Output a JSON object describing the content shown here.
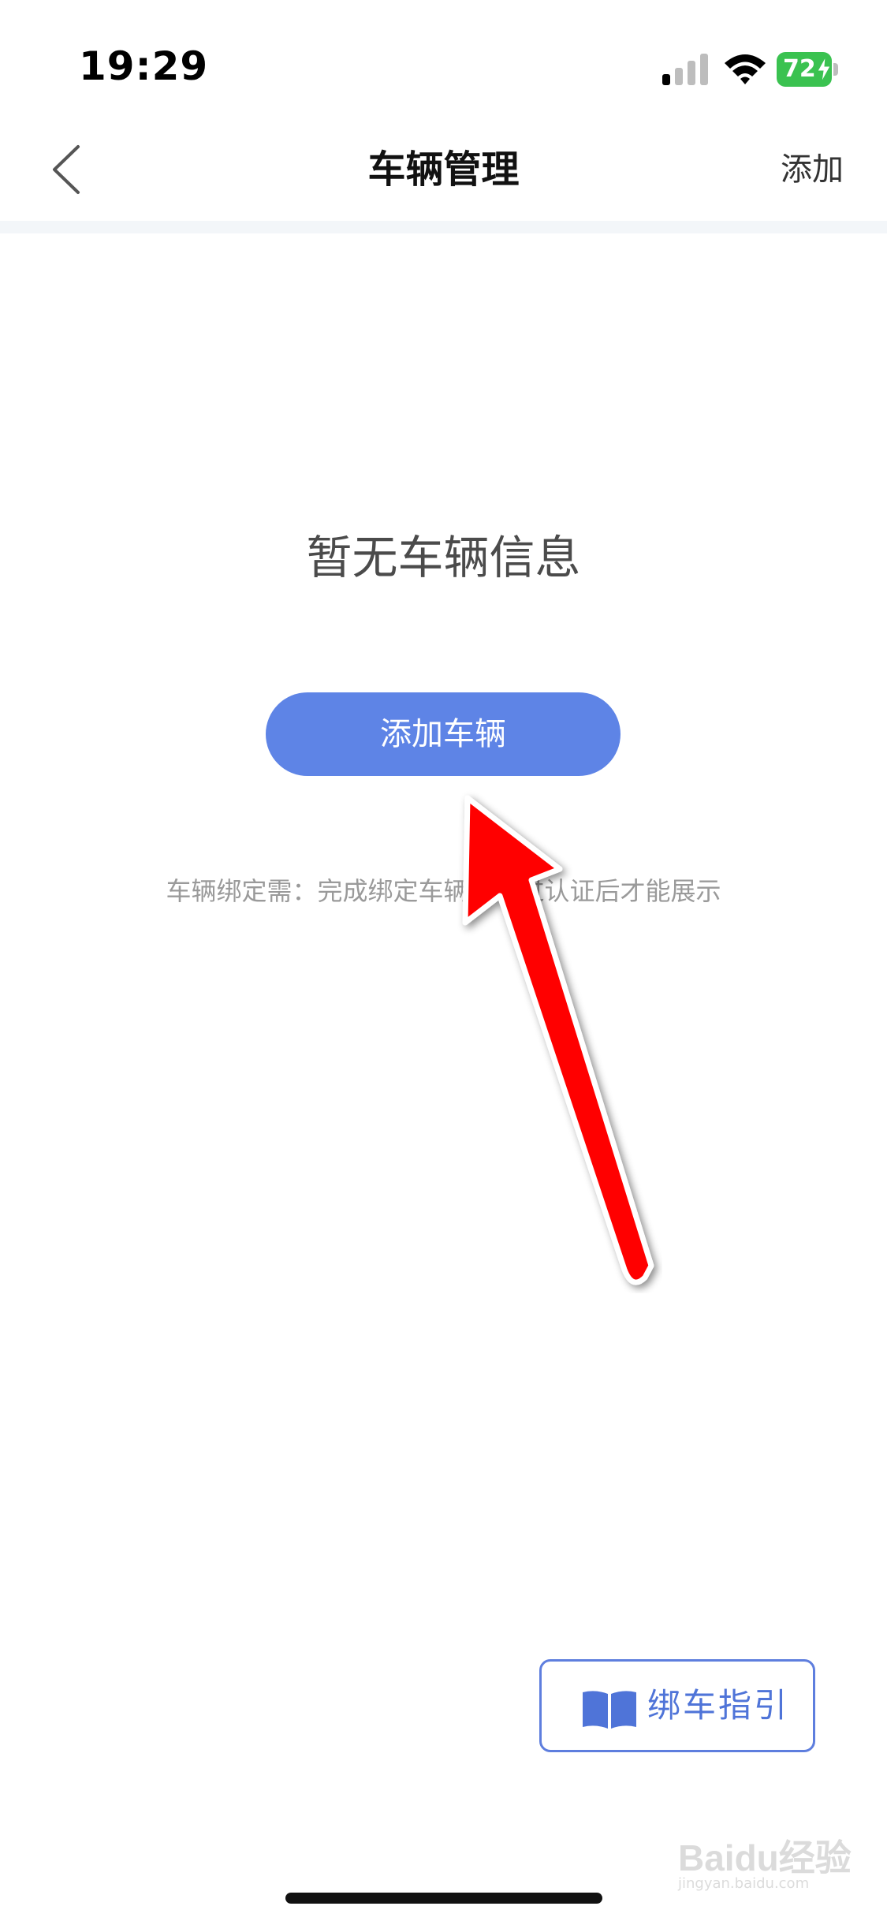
{
  "status_bar": {
    "time": "19:29",
    "battery_level": "72",
    "icons": [
      "signal-icon",
      "wifi-icon",
      "battery-icon"
    ]
  },
  "nav": {
    "title": "车辆管理",
    "right_action": "添加",
    "back_icon": "chevron-left-icon"
  },
  "empty_state": {
    "message": "暂无车辆信息",
    "button_label": "添加车辆",
    "hint": "车辆绑定需：完成绑定车辆并通过认证后才能展示"
  },
  "guide": {
    "label": "绑车指引",
    "icon": "book-icon"
  },
  "watermark": {
    "text": "Baidu经验",
    "sub": "jingyan.baidu.com"
  },
  "colors": {
    "accent": "#5e84e6",
    "annotation_arrow": "#ff0000",
    "battery": "#3ac250"
  }
}
